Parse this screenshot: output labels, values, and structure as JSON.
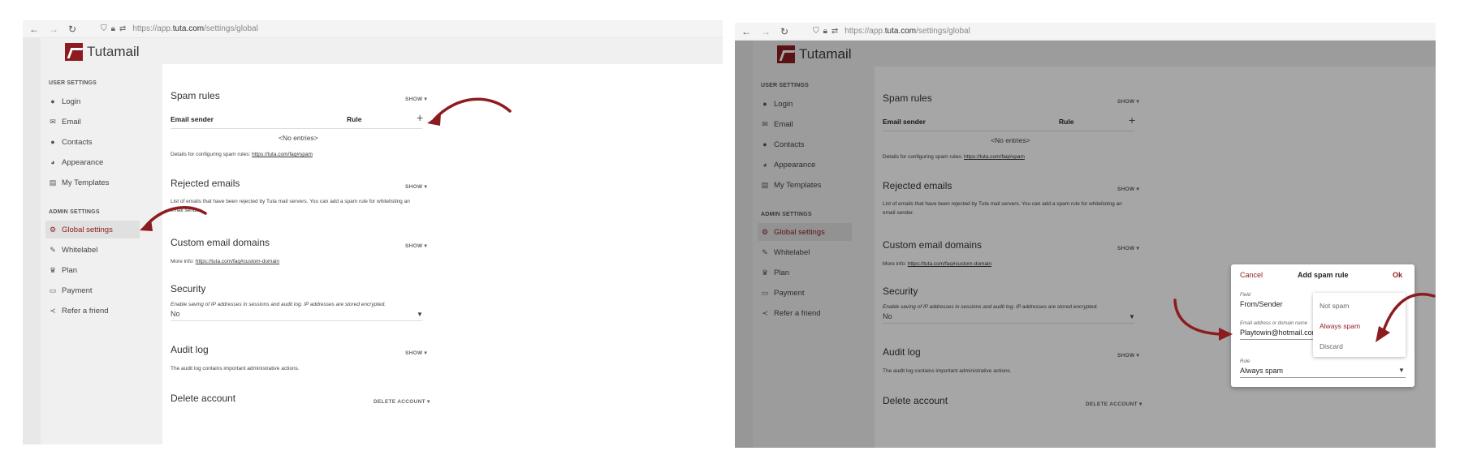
{
  "browser": {
    "url_prefix": "https://app.",
    "url_host": "tuta.com",
    "url_path": "/settings/global"
  },
  "logo": {
    "name_a": "Tuta",
    "name_b": "mail"
  },
  "sidebar": {
    "user_heading": "USER SETTINGS",
    "admin_heading": "ADMIN SETTINGS",
    "user_items": [
      {
        "label": "Login",
        "icon": "person-icon"
      },
      {
        "label": "Email",
        "icon": "envelope-icon"
      },
      {
        "label": "Contacts",
        "icon": "contacts-icon"
      },
      {
        "label": "Appearance",
        "icon": "palette-icon"
      },
      {
        "label": "My Templates",
        "icon": "templates-icon"
      }
    ],
    "admin_items": [
      {
        "label": "Global settings",
        "icon": "gear-icon"
      },
      {
        "label": "Whitelabel",
        "icon": "wand-icon"
      },
      {
        "label": "Plan",
        "icon": "trophy-icon"
      },
      {
        "label": "Payment",
        "icon": "card-icon"
      },
      {
        "label": "Refer a friend",
        "icon": "share-icon"
      }
    ]
  },
  "content": {
    "spam_title": "Spam rules",
    "show": "SHOW",
    "col_sender": "Email sender",
    "col_rule": "Rule",
    "no_entries": "<No entries>",
    "spam_details": "Details for configuring spam rules: ",
    "spam_link": "https://tuta.com/faq#spam",
    "rejected_title": "Rejected emails",
    "rejected_desc_1": "List of emails that have been rejected by Tuta mail servers. You can add a spam rule for whitelisting an",
    "rejected_desc_2": "email sender.",
    "domains_title": "Custom email domains",
    "domains_info": "More info: ",
    "domains_link": "https://tuta.com/faq#custom-domain",
    "security_title": "Security",
    "security_desc": "Enable saving of IP addresses in sessions and audit log. IP addresses are stored encrypted.",
    "security_value": "No",
    "audit_title": "Audit log",
    "audit_desc": "The audit log contains important administrative actions.",
    "delete_title": "Delete account",
    "delete_btn": "DELETE ACCOUNT"
  },
  "dialog": {
    "cancel": "Cancel",
    "title": "Add spam rule",
    "ok": "Ok",
    "field_label": "Field",
    "field_value": "From/Sender",
    "address_label": "Email address or domain name",
    "address_value": "Playtowin@hotmail.com",
    "rule_label": "Rule",
    "rule_value": "Always spam",
    "options": [
      "Not spam",
      "Always spam",
      "Discard"
    ]
  },
  "colors": {
    "accent": "#8c1c1f",
    "arrow": "#8c1c1f"
  }
}
